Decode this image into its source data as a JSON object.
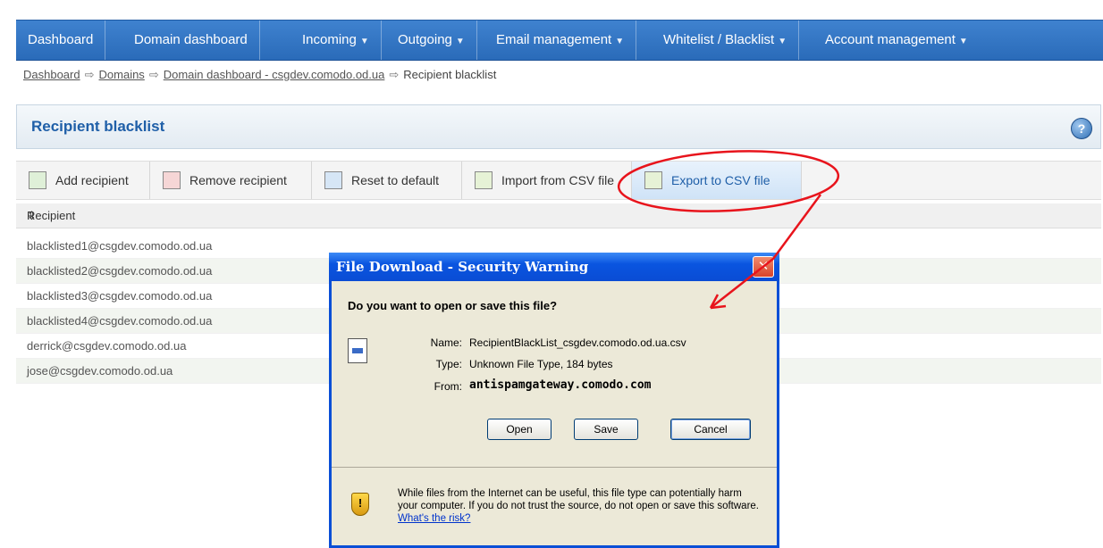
{
  "nav": {
    "items": [
      {
        "label": "Dashboard"
      },
      {
        "label": "Domain dashboard"
      },
      {
        "label": "Incoming"
      },
      {
        "label": "Outgoing"
      },
      {
        "label": "Email management"
      },
      {
        "label": "Whitelist / Blacklist"
      },
      {
        "label": "Account management"
      }
    ]
  },
  "breadcrumb": {
    "items": [
      "Dashboard",
      "Domains",
      "Domain dashboard - csgdev.comodo.od.ua",
      "Recipient blacklist"
    ]
  },
  "panel": {
    "title": "Recipient blacklist",
    "help": "?"
  },
  "toolbar": {
    "add": "Add recipient",
    "remove": "Remove recipient",
    "reset": "Reset to default",
    "import": "Import from CSV file",
    "export": "Export to CSV file"
  },
  "table": {
    "header": "Recipient",
    "rows": [
      "blacklisted1@csgdev.comodo.od.ua",
      "blacklisted2@csgdev.comodo.od.ua",
      "blacklisted3@csgdev.comodo.od.ua",
      "blacklisted4@csgdev.comodo.od.ua",
      "derrick@csgdev.comodo.od.ua",
      "jose@csgdev.comodo.od.ua"
    ]
  },
  "dialog": {
    "title": "File Download - Security Warning",
    "close": "✕",
    "question": "Do you want to open or save this file?",
    "name_label": "Name:",
    "name_value": "RecipientBlackList_csgdev.comodo.od.ua.csv",
    "type_label": "Type:",
    "type_value": "Unknown File Type, 184 bytes",
    "from_label": "From:",
    "from_value": "antispamgateway.comodo.com",
    "open": "Open",
    "save": "Save",
    "cancel": "Cancel",
    "warning": "While files from the Internet can be useful, this file type can potentially harm your computer. If you do not trust the source, do not open or save this software.",
    "risk_link": "What's the risk?"
  },
  "colors": {
    "nav": "#2a6bb9",
    "accent": "#1f5fa8",
    "annotation": "#e8141c"
  }
}
